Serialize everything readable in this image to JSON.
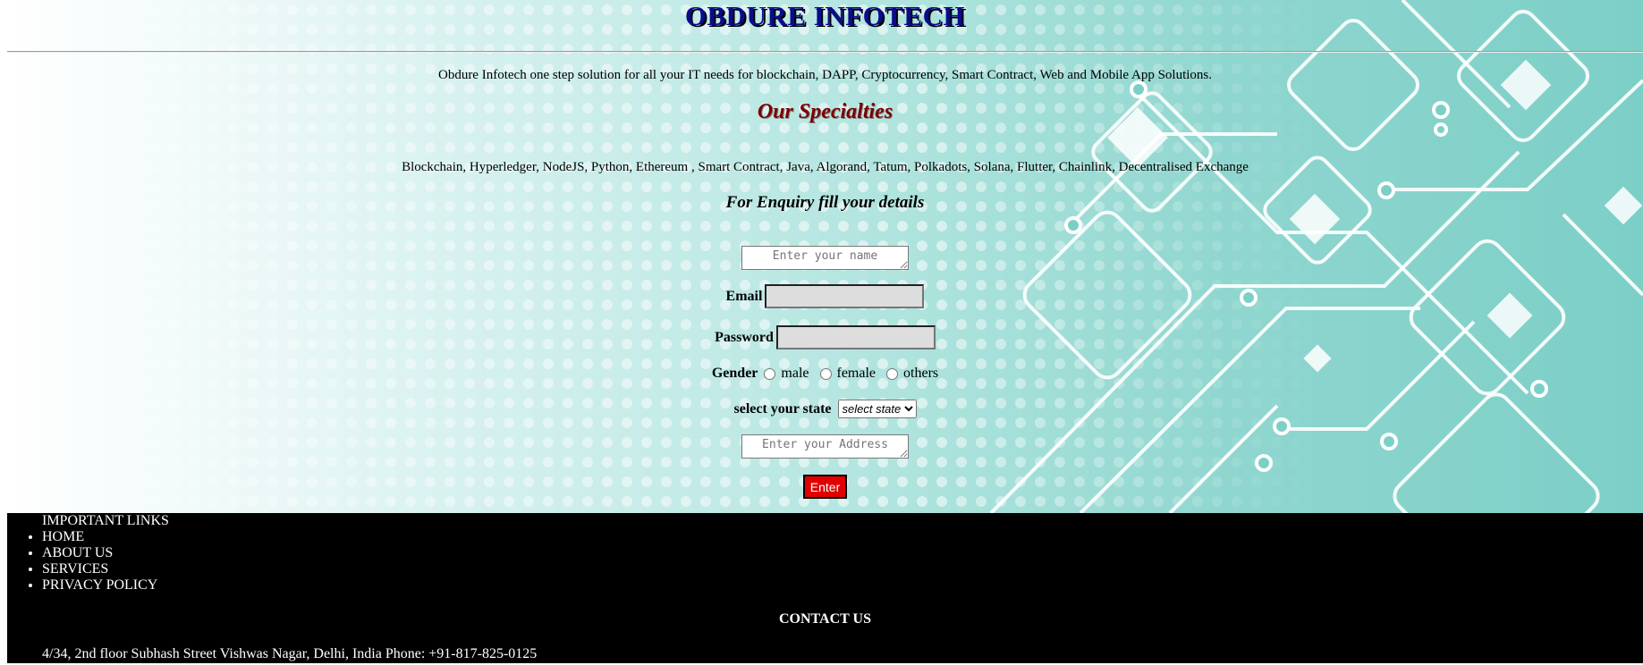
{
  "header": {
    "title": "OBDURE INFOTECH"
  },
  "intro": "Obdure Infotech one step solution for all your IT needs for blockchain, DAPP, Cryptocurrency, Smart Contract, Web and Mobile App Solutions.",
  "specialties": {
    "title": "Our Specialties",
    "list": "Blockchain, Hyperledger, NodeJS, Python, Ethereum , Smart Contract, Java, Algorand, Tatum, Polkadots, Solana, Flutter, Chainlink, Decentralised Exchange"
  },
  "form": {
    "heading": "For Enquiry fill your details",
    "name_placeholder": "Enter your name",
    "email_label": "Email",
    "password_label": "Password",
    "gender_label": "Gender",
    "gender_options": [
      "male",
      "female",
      "others"
    ],
    "state_label": "select your state",
    "state_selected": "select state",
    "address_placeholder": "Enter your Address",
    "submit_label": "Enter"
  },
  "footer": {
    "links_heading": "IMPORTANT LINKS",
    "links": [
      "HOME",
      "ABOUT US",
      "SERVICES",
      "PRIVACY POLICY"
    ],
    "contact_heading": "CONTACT US",
    "address": "4/34, 2nd floor Subhash Street Vishwas Nagar, Delhi, India Phone: +91-817-825-0125"
  },
  "colors": {
    "title": "#0b0b8c",
    "specialties_title": "#7a0000",
    "submit_bg": "#e00000",
    "footer_bg": "#000000",
    "hero_teal": "#7ccfc7"
  }
}
